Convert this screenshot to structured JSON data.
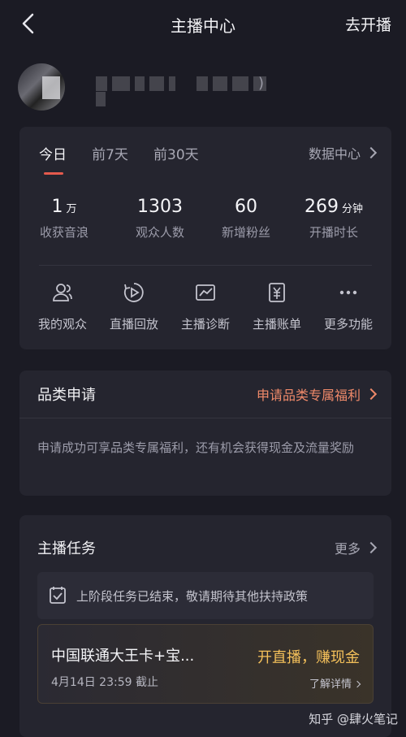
{
  "topbar": {
    "title": "主播中心",
    "start_live": "去开播"
  },
  "profile": {
    "name_suffix": ")"
  },
  "overview": {
    "tabs": [
      "今日",
      "前7天",
      "前30天"
    ],
    "active_tab": "今日",
    "data_center": "数据中心",
    "stats": [
      {
        "value": "1",
        "unit": "万",
        "label": "收获音浪"
      },
      {
        "value": "1303",
        "unit": "",
        "label": "观众人数"
      },
      {
        "value": "60",
        "unit": "",
        "label": "新增粉丝"
      },
      {
        "value": "269",
        "unit": "分钟",
        "label": "开播时长"
      }
    ],
    "actions": [
      {
        "label": "我的观众",
        "icon": "audience-icon"
      },
      {
        "label": "直播回放",
        "icon": "replay-icon"
      },
      {
        "label": "主播诊断",
        "icon": "diagnosis-icon"
      },
      {
        "label": "主播账单",
        "icon": "bill-icon"
      },
      {
        "label": "更多功能",
        "icon": "more-icon"
      }
    ]
  },
  "category": {
    "title": "品类申请",
    "link": "申请品类专属福利",
    "desc": "申请成功可享品类专属福利，还有机会获得现金及流量奖励"
  },
  "tasks": {
    "title": "主播任务",
    "more": "更多",
    "notice": "上阶段任务已结束，敬请期待其他扶持政策",
    "task": {
      "name": "中国联通大王卡+宝...",
      "deadline": "4月14日 23:59 截止",
      "cta": "开直播，赚现金",
      "detail": "了解详情"
    }
  },
  "watermark": "知乎 @肆火笔记",
  "colors": {
    "accent": "#e55a4d",
    "link": "#f08a6a",
    "cta": "#f4c05a",
    "bg": "#1b1b24",
    "card": "#25252f"
  }
}
